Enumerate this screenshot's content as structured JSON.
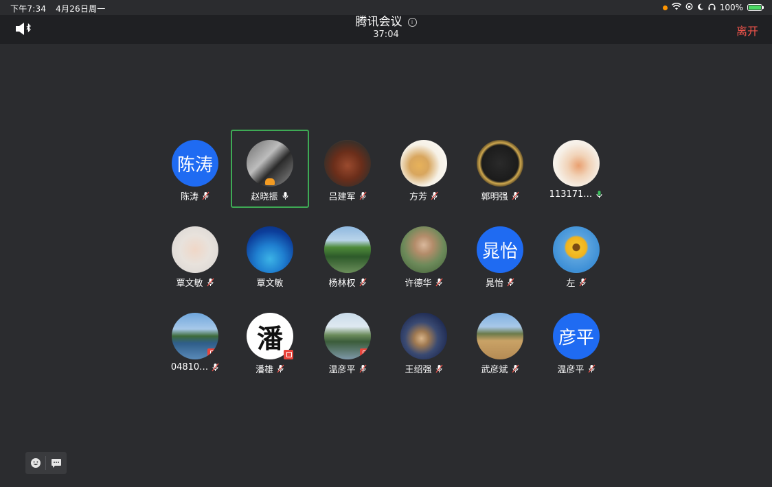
{
  "status_bar": {
    "time": "下午7:34",
    "date": "4月26日周一",
    "battery": "100%"
  },
  "header": {
    "title": "腾讯会议",
    "timer": "37:04",
    "leave_label": "离开"
  },
  "participants": [
    {
      "name": "陈涛",
      "avatar_text": "陈涛",
      "avatar_type": "text",
      "mic": "muted"
    },
    {
      "name": "赵晓振",
      "avatar_type": "photo",
      "mic": "on",
      "active": true
    },
    {
      "name": "吕建军",
      "avatar_type": "photo",
      "mic": "muted"
    },
    {
      "name": "方芳",
      "avatar_type": "photo",
      "mic": "muted"
    },
    {
      "name": "郭明强",
      "avatar_type": "photo",
      "mic": "muted"
    },
    {
      "name": "113171…",
      "avatar_type": "photo",
      "mic": "on"
    },
    {
      "name": "覃文敏",
      "avatar_type": "photo",
      "mic": "muted"
    },
    {
      "name": "覃文敏",
      "avatar_type": "photo",
      "mic": "none"
    },
    {
      "name": "杨林权",
      "avatar_type": "photo",
      "mic": "muted"
    },
    {
      "name": "许德华",
      "avatar_type": "photo",
      "mic": "muted"
    },
    {
      "name": "晁怡",
      "avatar_text": "晁怡",
      "avatar_type": "text",
      "mic": "muted"
    },
    {
      "name": "左",
      "avatar_type": "photo",
      "mic": "muted"
    },
    {
      "name": "04810…",
      "avatar_type": "photo",
      "mic": "muted"
    },
    {
      "name": "潘雄",
      "avatar_text": "潘",
      "avatar_type": "photo",
      "mic": "muted"
    },
    {
      "name": "温彦平",
      "avatar_type": "photo",
      "mic": "muted"
    },
    {
      "name": "王绍强",
      "avatar_type": "photo",
      "mic": "muted"
    },
    {
      "name": "武彦斌",
      "avatar_type": "photo",
      "mic": "muted"
    },
    {
      "name": "温彦平",
      "avatar_text": "彦平",
      "avatar_type": "text",
      "mic": "muted"
    }
  ],
  "colors": {
    "background": "#2b2c2f",
    "header": "#1f2023",
    "leave": "#f0544b",
    "active_border": "#3eaa55",
    "avatar_blue": "#1f6bf2",
    "mic_on": "#3bbf5e"
  },
  "icons": {
    "speaker": "speaker-bluetooth-icon",
    "info": "info-icon",
    "emoji": "emoji-icon",
    "chat": "chat-icon"
  }
}
